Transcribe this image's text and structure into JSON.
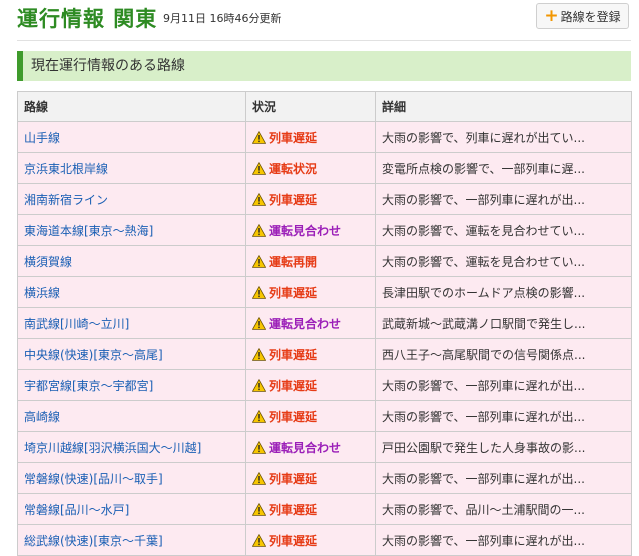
{
  "header": {
    "title": "運行情報 関東",
    "updated": "9月11日 16時46分更新",
    "register_button": "路線を登録"
  },
  "section_title": "現在運行情報のある路線",
  "table": {
    "columns": [
      "路線",
      "状況",
      "詳細"
    ],
    "rows": [
      {
        "route": "山手線",
        "status": "列車遅延",
        "status_type": "red",
        "detail": "大雨の影響で、列車に遅れが出てい..."
      },
      {
        "route": "京浜東北根岸線",
        "status": "運転状況",
        "status_type": "red",
        "detail": "変電所点検の影響で、一部列車に遅..."
      },
      {
        "route": "湘南新宿ライン",
        "status": "列車遅延",
        "status_type": "red",
        "detail": "大雨の影響で、一部列車に遅れが出..."
      },
      {
        "route": "東海道本線[東京～熱海]",
        "status": "運転見合わせ",
        "status_type": "purple",
        "detail": "大雨の影響で、運転を見合わせてい..."
      },
      {
        "route": "横須賀線",
        "status": "運転再開",
        "status_type": "red",
        "detail": "大雨の影響で、運転を見合わせてい..."
      },
      {
        "route": "横浜線",
        "status": "列車遅延",
        "status_type": "red",
        "detail": "長津田駅でのホームドア点検の影響..."
      },
      {
        "route": "南武線[川崎～立川]",
        "status": "運転見合わせ",
        "status_type": "purple",
        "detail": "武蔵新城～武蔵溝ノ口駅間で発生し..."
      },
      {
        "route": "中央線(快速)[東京～高尾]",
        "status": "列車遅延",
        "status_type": "red",
        "detail": "西八王子～高尾駅間での信号関係点..."
      },
      {
        "route": "宇都宮線[東京～宇都宮]",
        "status": "列車遅延",
        "status_type": "red",
        "detail": "大雨の影響で、一部列車に遅れが出..."
      },
      {
        "route": "高崎線",
        "status": "列車遅延",
        "status_type": "red",
        "detail": "大雨の影響で、一部列車に遅れが出..."
      },
      {
        "route": "埼京川越線[羽沢横浜国大～川越]",
        "status": "運転見合わせ",
        "status_type": "purple",
        "detail": "戸田公園駅で発生した人身事故の影..."
      },
      {
        "route": "常磐線(快速)[品川～取手]",
        "status": "列車遅延",
        "status_type": "red",
        "detail": "大雨の影響で、一部列車に遅れが出..."
      },
      {
        "route": "常磐線[品川～水戸]",
        "status": "列車遅延",
        "status_type": "red",
        "detail": "大雨の影響で、品川～土浦駅間の一..."
      },
      {
        "route": "総武線(快速)[東京～千葉]",
        "status": "列車遅延",
        "status_type": "red",
        "detail": "大雨の影響で、一部列車に遅れが出..."
      }
    ]
  },
  "colors": {
    "title_green": "#2e8b23",
    "section_bg": "#d8efc9",
    "row_bg": "#fdeaf1",
    "status_red": "#e63b16",
    "status_purple": "#9b1fb8",
    "link_blue": "#1a5fb4",
    "warn_yellow": "#f7c600"
  },
  "icons": {
    "register": "plus-icon",
    "status": "warning-icon"
  }
}
